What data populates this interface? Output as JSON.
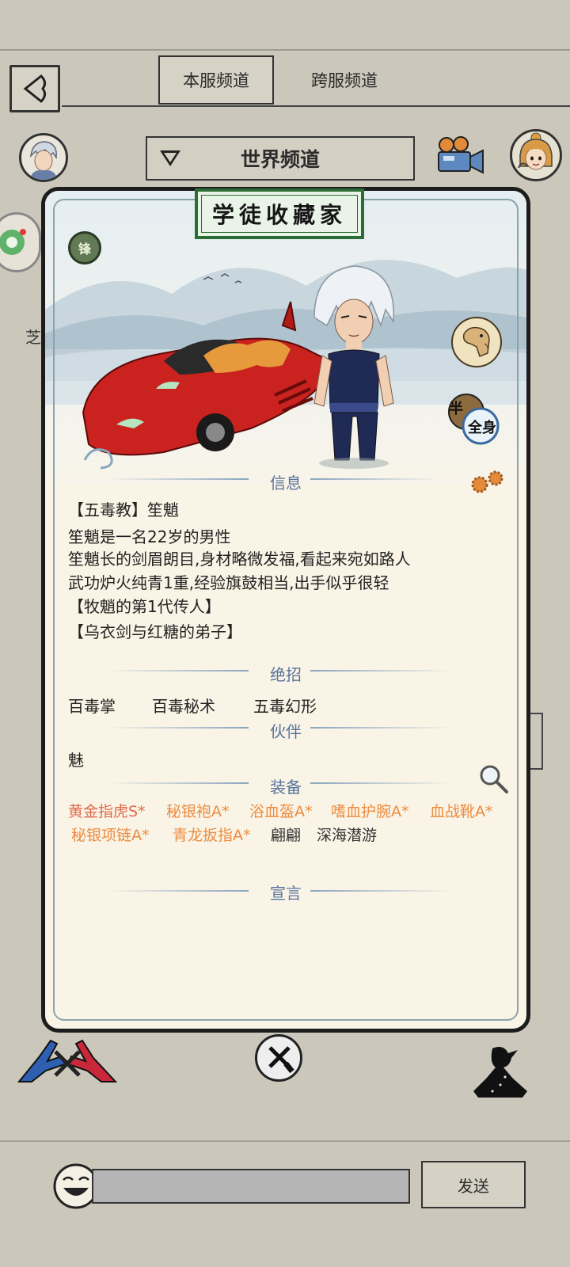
{
  "header": {
    "back_icon": "back-arrow-icon",
    "tabs": [
      {
        "label": "本服频道",
        "active": true
      },
      {
        "label": "跨服频道",
        "active": false
      }
    ]
  },
  "channel_bar": {
    "selected_channel": "世界频道",
    "dropdown_icon": "triangle-down-icon",
    "camera_icon": "movie-camera-icon"
  },
  "background": {
    "partial_char": "芝"
  },
  "card": {
    "title": "学徒收藏家",
    "badge": "锋",
    "side_buttons": [
      "camel-icon",
      "half-full-body-toggle-icon"
    ],
    "half_toggle_text": [
      "半",
      "全身"
    ],
    "sections": {
      "info": {
        "heading": "信息",
        "lines": [
          "【五毒教】笙魈",
          "笙魈是一名22岁的男性",
          "笙魈长的剑眉朗目,身材略微发福,看起来宛如路人",
          "武功炉火纯青1重,经验旗鼓相当,出手似乎很轻",
          "【牧魈的第1代传人】",
          "【乌衣剑与红糖的弟子】"
        ]
      },
      "skills": {
        "heading": "绝招",
        "items": [
          "百毒掌",
          "百毒秘术",
          "五毒幻形"
        ]
      },
      "partner": {
        "heading": "伙伴",
        "value": "魅"
      },
      "equipment": {
        "heading": "装备",
        "row1": [
          {
            "name": "黄金指虎S*",
            "color": "#e06a4c"
          },
          {
            "name": "秘银袍A*",
            "color": "#ec8b3f"
          },
          {
            "name": "浴血盔A*",
            "color": "#ec8b3f"
          },
          {
            "name": "嗜血护腕A*",
            "color": "#ec8b3f"
          },
          {
            "name": "血战靴A*",
            "color": "#ec8b3f"
          }
        ],
        "row2": [
          {
            "name": "秘银项链A*",
            "color": "#ec8b3f"
          },
          {
            "name": "青龙扳指A*",
            "color": "#ec8b3f"
          },
          {
            "name": "翩翩",
            "color": "#333333"
          },
          {
            "name": "深海潜游",
            "color": "#333333"
          }
        ]
      },
      "declaration": {
        "heading": "宣言",
        "value": ""
      }
    }
  },
  "footer": {
    "left_icon": "crossed-swords-fighters-icon",
    "close_icon": "close-sword-icon",
    "right_icon": "meditating-figure-icon",
    "emoji_icon": "laughing-face-icon",
    "input_value": "",
    "send_label": "发送"
  }
}
